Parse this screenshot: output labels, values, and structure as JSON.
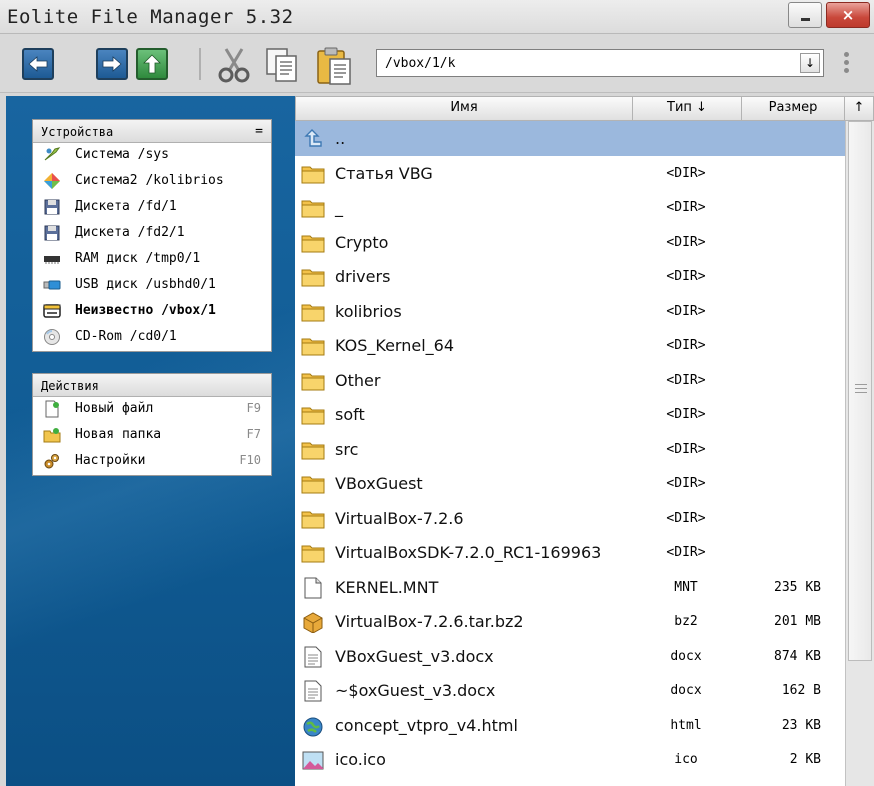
{
  "window": {
    "title": "Eolite File Manager 5.32"
  },
  "toolbar": {
    "path": "/vbox/1/k",
    "dropdown_glyph": "↓",
    "buttons": [
      "back-icon",
      "forward-icon",
      "up-icon",
      "cut-icon",
      "copy-icon",
      "paste-icon"
    ]
  },
  "devices": {
    "header": "Устройства",
    "menu_glyph": "=",
    "items": [
      {
        "label": "Система /sys",
        "icon": "system-icon"
      },
      {
        "label": "Система2 /kolibrios",
        "icon": "system2-icon"
      },
      {
        "label": "Дискета /fd/1",
        "icon": "floppy-icon"
      },
      {
        "label": "Дискета /fd2/1",
        "icon": "floppy-icon"
      },
      {
        "label": "RAM диск /tmp0/1",
        "icon": "ram-icon"
      },
      {
        "label": "USB диск /usbhd0/1",
        "icon": "usb-icon"
      },
      {
        "label": "Неизвестно /vbox/1",
        "icon": "drive-icon",
        "bold": true
      },
      {
        "label": "CD-Rom /cd0/1",
        "icon": "cdrom-icon"
      }
    ]
  },
  "actions": {
    "header": "Действия",
    "items": [
      {
        "label": "Новый файл",
        "key": "F9",
        "icon": "new-file-icon"
      },
      {
        "label": "Новая папка",
        "key": "F7",
        "icon": "new-folder-icon"
      },
      {
        "label": "Настройки",
        "key": "F10",
        "icon": "settings-icon"
      }
    ]
  },
  "columns": {
    "name": "Имя",
    "type": "Тип ↓",
    "size": "Размер",
    "sort": "↑"
  },
  "files": [
    {
      "name": "..",
      "type": "",
      "size": "",
      "icon": "up-folder-icon",
      "selected": true
    },
    {
      "name": "Статья VBG",
      "type": "<DIR>",
      "size": "",
      "icon": "folder-icon"
    },
    {
      "name": "_",
      "type": "<DIR>",
      "size": "",
      "icon": "folder-icon"
    },
    {
      "name": "Crypto",
      "type": "<DIR>",
      "size": "",
      "icon": "folder-icon"
    },
    {
      "name": "drivers",
      "type": "<DIR>",
      "size": "",
      "icon": "folder-icon"
    },
    {
      "name": "kolibrios",
      "type": "<DIR>",
      "size": "",
      "icon": "folder-icon"
    },
    {
      "name": "KOS_Kernel_64",
      "type": "<DIR>",
      "size": "",
      "icon": "folder-icon"
    },
    {
      "name": "Other",
      "type": "<DIR>",
      "size": "",
      "icon": "folder-icon"
    },
    {
      "name": "soft",
      "type": "<DIR>",
      "size": "",
      "icon": "folder-icon"
    },
    {
      "name": "src",
      "type": "<DIR>",
      "size": "",
      "icon": "folder-icon"
    },
    {
      "name": "VBoxGuest",
      "type": "<DIR>",
      "size": "",
      "icon": "folder-icon"
    },
    {
      "name": "VirtualBox-7.2.6",
      "type": "<DIR>",
      "size": "",
      "icon": "folder-icon"
    },
    {
      "name": "VirtualBoxSDK-7.2.0_RC1-169963",
      "type": "<DIR>",
      "size": "",
      "icon": "folder-icon"
    },
    {
      "name": "KERNEL.MNT",
      "type": "MNT",
      "size": "235 KB",
      "icon": "file-icon"
    },
    {
      "name": "VirtualBox-7.2.6.tar.bz2",
      "type": "bz2",
      "size": "201 MB",
      "icon": "archive-icon"
    },
    {
      "name": "VBoxGuest_v3.docx",
      "type": "docx",
      "size": "874 KB",
      "icon": "document-icon"
    },
    {
      "name": "~$oxGuest_v3.docx",
      "type": "docx",
      "size": "162 B",
      "icon": "document-icon"
    },
    {
      "name": "concept_vtpro_v4.html",
      "type": "html",
      "size": "23 KB",
      "icon": "html-icon"
    },
    {
      "name": "ico.ico",
      "type": "ico",
      "size": "2 KB",
      "icon": "image-icon"
    },
    {
      "name": "",
      "type": "",
      "size": "",
      "icon": "disk-image-icon"
    }
  ]
}
